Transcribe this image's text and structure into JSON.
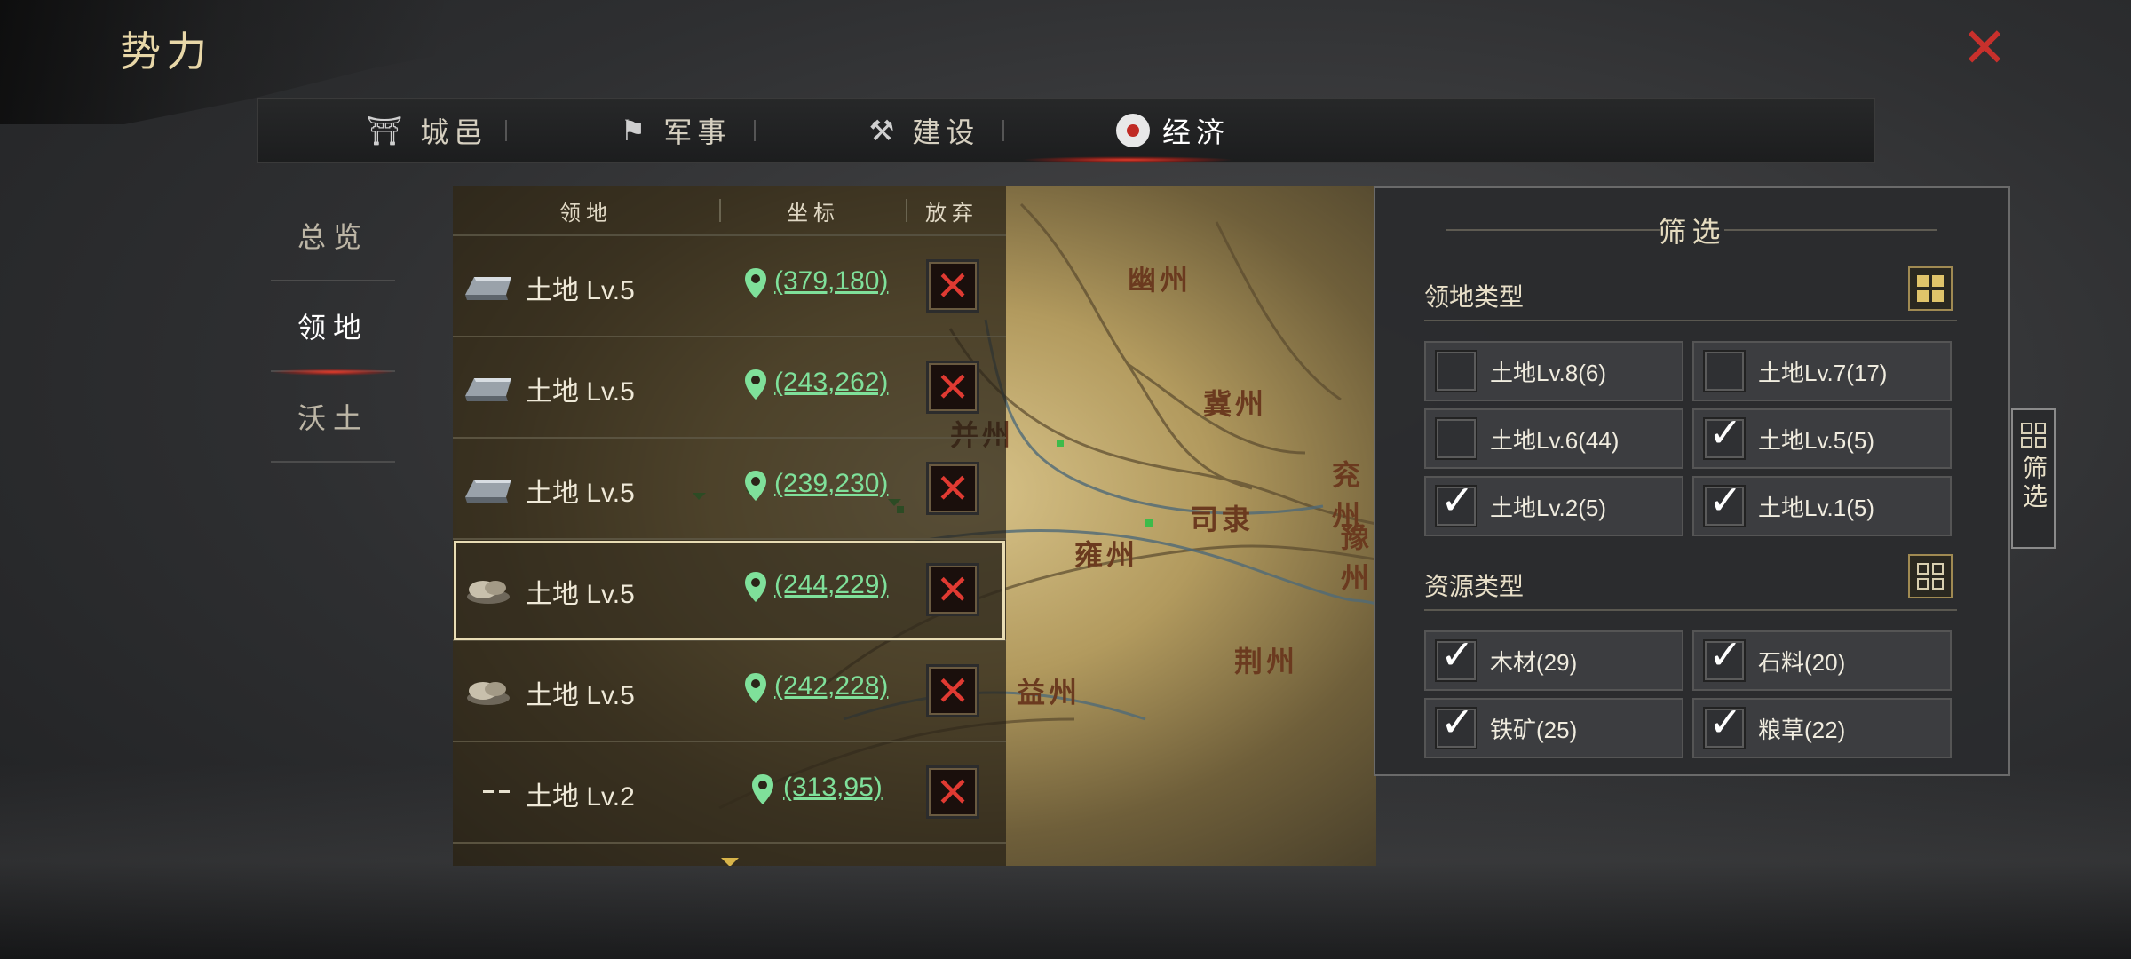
{
  "header": {
    "title": "势力",
    "close_icon": "close-icon"
  },
  "tabs": [
    {
      "label": "城邑",
      "icon": "city-gate-icon"
    },
    {
      "label": "军事",
      "icon": "flag-icon"
    },
    {
      "label": "建设",
      "icon": "hammer-icon"
    },
    {
      "label": "经济",
      "icon": "coin-icon",
      "active": true
    }
  ],
  "leftnav": [
    {
      "label": "总览"
    },
    {
      "label": "领地",
      "active": true
    },
    {
      "label": "沃土"
    }
  ],
  "list": {
    "headers": {
      "territory": "领地",
      "coords": "坐标",
      "abandon": "放弃"
    },
    "rows": [
      {
        "icon": "iron-ingot-icon",
        "name": "土地 Lv.5",
        "coord": "(379,180)"
      },
      {
        "icon": "iron-ingot-icon",
        "name": "土地 Lv.5",
        "coord": "(243,262)"
      },
      {
        "icon": "iron-ingot-icon",
        "name": "土地 Lv.5",
        "coord": "(239,230)"
      },
      {
        "icon": "stone-icon",
        "name": "土地 Lv.5",
        "coord": "(244,229)",
        "selected": true
      },
      {
        "icon": "stone-icon",
        "name": "土地 Lv.5",
        "coord": "(242,228)"
      },
      {
        "icon": "dash-icon",
        "name": "土地 Lv.2",
        "coord": "(313,95)"
      }
    ]
  },
  "map": {
    "regions": [
      "幽州",
      "冀州",
      "并州",
      "司隶",
      "雍州",
      "兖州",
      "豫州",
      "荆州",
      "益州"
    ]
  },
  "filter": {
    "title": "筛选",
    "territory_type": {
      "label": "领地类型",
      "options": [
        {
          "label": "土地Lv.8(6)",
          "checked": false
        },
        {
          "label": "土地Lv.7(17)",
          "checked": false
        },
        {
          "label": "土地Lv.6(44)",
          "checked": false
        },
        {
          "label": "土地Lv.5(5)",
          "checked": true
        },
        {
          "label": "土地Lv.2(5)",
          "checked": true
        },
        {
          "label": "土地Lv.1(5)",
          "checked": true
        }
      ]
    },
    "resource_type": {
      "label": "资源类型",
      "options": [
        {
          "label": "木材(29)",
          "checked": true
        },
        {
          "label": "石料(20)",
          "checked": true
        },
        {
          "label": "铁矿(25)",
          "checked": true
        },
        {
          "label": "粮草(22)",
          "checked": true
        }
      ]
    },
    "side_tab_label": "筛选"
  },
  "colors": {
    "coord": "#7fe09a",
    "accent_red": "#c8302c",
    "gold": "#e0c46a"
  }
}
